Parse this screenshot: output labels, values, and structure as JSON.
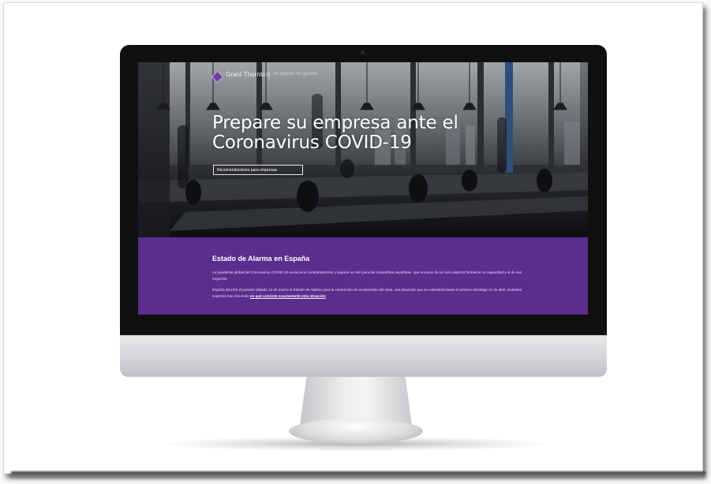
{
  "site": {
    "brand": "Grant Thornton",
    "tagline": "An instinct for growth"
  },
  "hero": {
    "title_line1": "Prepare su empresa ante el",
    "title_line2": "Coronavirus COVID-19",
    "cta_label": "Recomendaciones para empresas"
  },
  "info": {
    "heading": "Estado de Alarma en España",
    "paragraph1": "La pandemia global del Coronavirus COVID-19 evoluciona constantemente y supone un reto para las compañías españolas, que encaran de un solo aspecto fortalecer su capacidad y el de sus negocios.",
    "paragraph2": "España decretó el pasado sábado 14 de marzo el Estado de Alarma para la contención de la extensión del virus, una situación que se extenderá hasta el próximo domingo 12 de abril. Nuestros expertos han resumido",
    "link_text": "en qué consiste exactamente esta situación"
  },
  "colors": {
    "accent_purple": "#5b2d8e",
    "bezel": "#101010",
    "chin": "#d4d5d8"
  },
  "icons": {
    "logo": "diamond-logo-icon"
  }
}
